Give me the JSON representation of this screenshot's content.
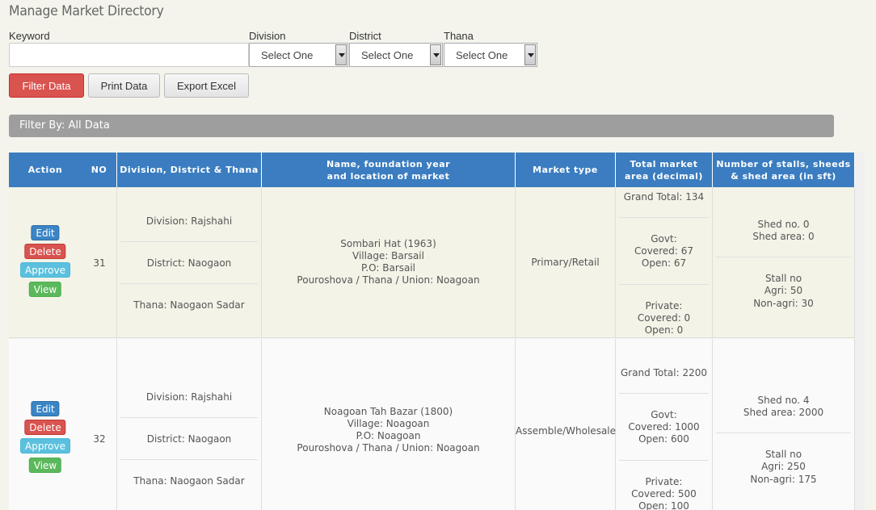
{
  "page_title": "Manage Market Directory",
  "filters": {
    "keyword_label": "Keyword",
    "keyword_value": "",
    "division_label": "Division",
    "district_label": "District",
    "thana_label": "Thana",
    "division_value": "Select One",
    "district_value": "Select One",
    "thana_value": "Select One"
  },
  "buttons": {
    "filter": "Filter Data",
    "print": "Print Data",
    "export": "Export Excel"
  },
  "filter_by": "Filter By: All Data",
  "table": {
    "headers": {
      "action": "Action",
      "no": "NO",
      "location": "Division, District & Thana",
      "name_line1": "Name, foundation year",
      "name_line2": "and location of market",
      "type": "Market type",
      "area_line1": "Total market",
      "area_line2": "area (decimal)",
      "stalls_line1": "Number of stalls, sheeds",
      "stalls_line2": "& shed area (in sft)"
    },
    "action_labels": {
      "edit": "Edit",
      "delete": "Delete",
      "approve": "Approve",
      "view": "View"
    },
    "rows": [
      {
        "no": "31",
        "division": "Division: Rajshahi",
        "district": "District: Naogaon",
        "thana": "Thana: Naogaon Sadar",
        "name": "Sombari Hat (1963)",
        "village": "Village: Barsail",
        "po": "P.O: Barsail",
        "union": "Pouroshova / Thana / Union: Noagoan",
        "market_type": "Primary/Retail",
        "grand_total": "Grand Total: 134",
        "govt_title": "Govt:",
        "govt_covered": "Covered: 67",
        "govt_open": "Open: 67",
        "private_title": "Private:",
        "private_covered": "Covered: 0",
        "private_open": "Open: 0",
        "shed_no": "Shed no. 0",
        "shed_area": "Shed area: 0",
        "stall_title": "Stall no",
        "stall_agri": "Agri: 50",
        "stall_nonagri": "Non-agri: 30"
      },
      {
        "no": "32",
        "division": "Division: Rajshahi",
        "district": "District: Naogaon",
        "thana": "Thana: Naogaon Sadar",
        "name": "Noagoan Tah Bazar (1800)",
        "village": "Village: Noagoan",
        "po": "P.O: Noagoan",
        "union": "Pouroshova / Thana / Union: Noagoan",
        "market_type": "Assemble/Wholesale",
        "grand_total": "Grand Total: 2200",
        "govt_title": "Govt:",
        "govt_covered": "Covered: 1000",
        "govt_open": "Open: 600",
        "private_title": "Private:",
        "private_covered": "Covered: 500",
        "private_open": "Open: 100",
        "shed_no": "Shed no. 4",
        "shed_area": "Shed area: 2000",
        "stall_title": "Stall no",
        "stall_agri": "Agri: 250",
        "stall_nonagri": "Non-agri: 175"
      }
    ]
  }
}
